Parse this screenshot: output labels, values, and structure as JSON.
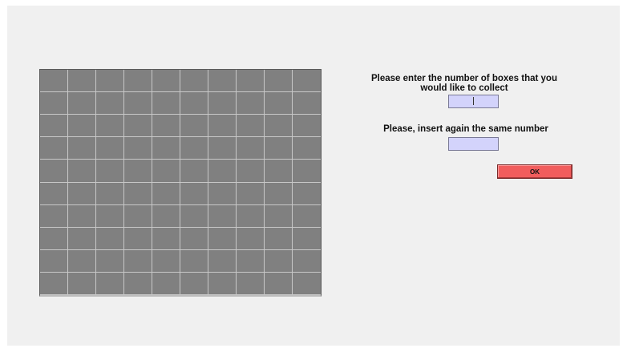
{
  "form": {
    "prompt_first": "Please enter the number of boxes that you would like to collect",
    "input_first_value": "",
    "prompt_second": "Please, insert again the same number",
    "input_second_value": "",
    "ok_label": "OK"
  },
  "grid": {
    "rows": 10,
    "columns": 10,
    "box_color": "#808080",
    "line_color": "#c8c8c8"
  },
  "colors": {
    "background": "#f0f0f0",
    "input_fill": "#d3d3fb",
    "ok_button": "#f15d5d"
  }
}
